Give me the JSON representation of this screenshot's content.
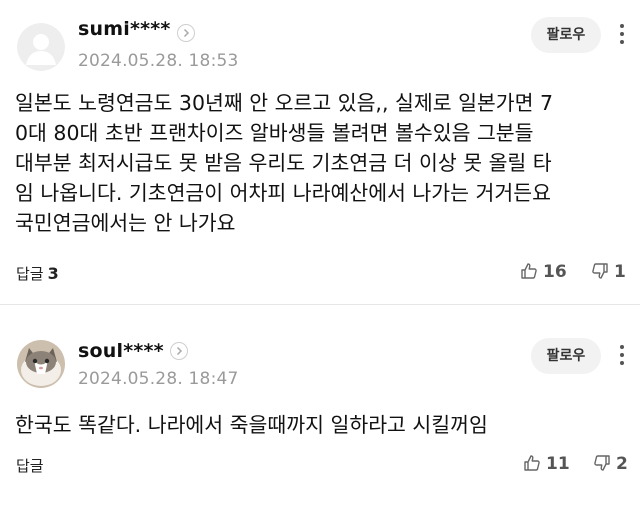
{
  "comments": [
    {
      "username": "sumi****",
      "date": "2024.05.28. 18:53",
      "follow_label": "팔로우",
      "lines": [
        "일본도 노령연금도 30년째 안 오르고 있음,, 실제로 일본가면 7",
        "0대 80대 초반 프랜차이즈 알바생들 볼려면 볼수있음 그분들",
        "대부분 최저시급도 못 받음 우리도 기초연금 더 이상 못 올릴 타",
        "임 나옵니다. 기초연금이 어차피 나라예산에서 나가는 거거든요",
        "국민연금에서는 안 나가요"
      ],
      "reply_label": "답글",
      "reply_count": "3",
      "likes": "16",
      "dislikes": "1",
      "avatar": "default-profile"
    },
    {
      "username": "soul****",
      "date": "2024.05.28. 18:47",
      "follow_label": "팔로우",
      "lines": [
        "한국도 똑같다. 나라에서 죽을때까지 일하라고 시킬꺼임"
      ],
      "reply_label": "답글",
      "reply_count": "",
      "likes": "11",
      "dislikes": "2",
      "avatar": "cat-photo"
    }
  ],
  "icons": {
    "chevron": "chevron-right-icon",
    "like": "thumbs-up-icon",
    "dislike": "thumbs-down-icon",
    "more": "more-vertical-icon"
  }
}
